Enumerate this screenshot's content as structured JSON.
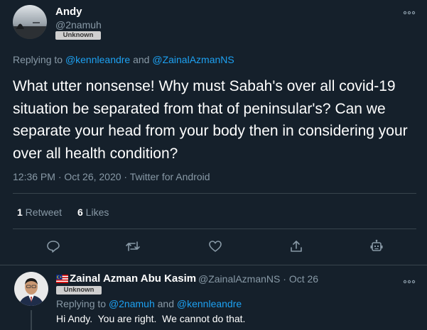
{
  "main_tweet": {
    "author_name": "Andy",
    "author_handle": "@2namuh",
    "badge": "Unknown",
    "replying_prefix": "Replying to ",
    "replying_to_1": "@kennleandre",
    "replying_and": " and ",
    "replying_to_2": "@ZainalAzmanNS",
    "text": "What utter nonsense! Why must Sabah's over all covid-19 situation be separated from that of peninsular's? Can we separate your head from your body then in considering your over all health condition?",
    "meta": "12:36 PM · Oct 26, 2020 · Twitter for Android",
    "stats": {
      "retweets_count": "1",
      "retweets_label": " Retweet",
      "likes_count": "6",
      "likes_label": " Likes"
    },
    "more_icon": "more-horizontal-icon"
  },
  "actions": [
    {
      "name": "reply-icon"
    },
    {
      "name": "retweet-icon"
    },
    {
      "name": "like-icon"
    },
    {
      "name": "share-icon"
    },
    {
      "name": "bot-icon"
    }
  ],
  "reply_tweet": {
    "flag": "malaysia-flag-icon",
    "author_name": "Zainal Azman Abu Kasim",
    "author_handle": "@ZainalAzmanNS",
    "date": " · Oct 26",
    "badge": "Unknown",
    "replying_prefix": "Replying to ",
    "replying_to_1": "@2namuh",
    "replying_and": " and ",
    "replying_to_2": "@kennleandre",
    "text": "Hi Andy.  You are right.  We cannot do that."
  },
  "colors": {
    "background": "#15202b",
    "link": "#1da1f2",
    "secondary_text": "#8899a6",
    "divider": "#38444d"
  }
}
